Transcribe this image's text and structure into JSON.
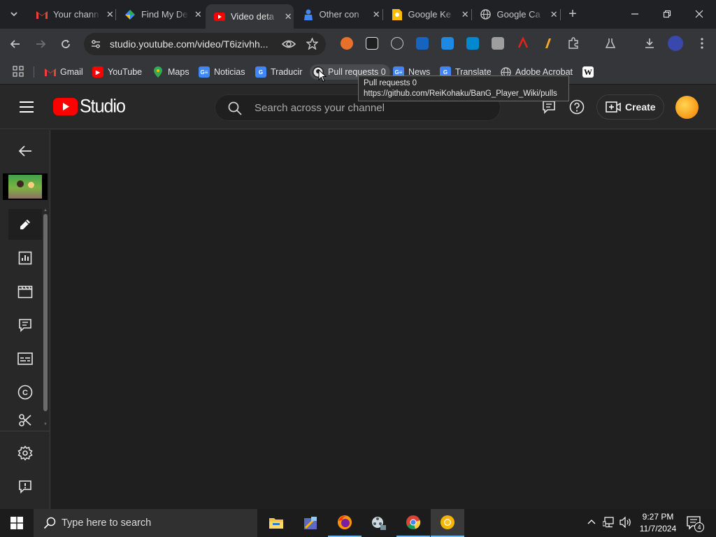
{
  "browser": {
    "tabs": [
      {
        "title": "Your chann",
        "favicon": "gmail-icon",
        "active": false
      },
      {
        "title": "Find My De",
        "favicon": "find-my-device-icon",
        "active": false
      },
      {
        "title": "Video deta",
        "favicon": "youtube-icon",
        "active": true
      },
      {
        "title": "Other con",
        "favicon": "person-icon",
        "active": false
      },
      {
        "title": "Google Ke",
        "favicon": "google-keep-icon",
        "active": false
      },
      {
        "title": "Google Ca",
        "favicon": "globe-icon",
        "active": false
      }
    ],
    "url": "studio.youtube.com/video/T6izivhh...",
    "bookmarks": [
      {
        "label": "Gmail",
        "icon": "gmail-icon"
      },
      {
        "label": "YouTube",
        "icon": "youtube-icon"
      },
      {
        "label": "Maps",
        "icon": "maps-pin-icon"
      },
      {
        "label": "Noticias",
        "icon": "google-news-icon"
      },
      {
        "label": "Traducir",
        "icon": "google-translate-icon"
      },
      {
        "label": "Pull requests 0",
        "icon": "github-icon"
      },
      {
        "label": "News",
        "icon": "google-news-icon"
      },
      {
        "label": "Translate",
        "icon": "google-translate-icon"
      },
      {
        "label": "Adobe Acrobat",
        "icon": "globe-icon"
      },
      {
        "label": "",
        "icon": "wikipedia-icon"
      }
    ],
    "tooltip": {
      "title": "Pull requests 0",
      "url": "https://github.com/ReiKohaku/BanG_Player_Wiki/pulls"
    }
  },
  "studio": {
    "logo_text": "Studio",
    "search_placeholder": "Search across your channel",
    "create_label": "Create",
    "sidebar_items": [
      {
        "name": "back-arrow-icon",
        "active": false
      },
      {
        "name": "details-edit-icon",
        "active": true
      },
      {
        "name": "analytics-icon",
        "active": false
      },
      {
        "name": "editor-clapper-icon",
        "active": false
      },
      {
        "name": "comments-icon",
        "active": false
      },
      {
        "name": "subtitles-icon",
        "active": false
      },
      {
        "name": "copyright-icon",
        "active": false
      },
      {
        "name": "clips-scissors-icon",
        "active": false
      },
      {
        "name": "settings-gear-icon",
        "active": false
      },
      {
        "name": "feedback-icon",
        "active": false
      }
    ]
  },
  "taskbar": {
    "search_placeholder": "Type here to search",
    "time": "9:27 PM",
    "date": "11/7/2024",
    "notification_count": "4"
  },
  "colors": {
    "youtube_red": "#ff0000",
    "background": "#1f1f1f",
    "header": "#282828"
  }
}
